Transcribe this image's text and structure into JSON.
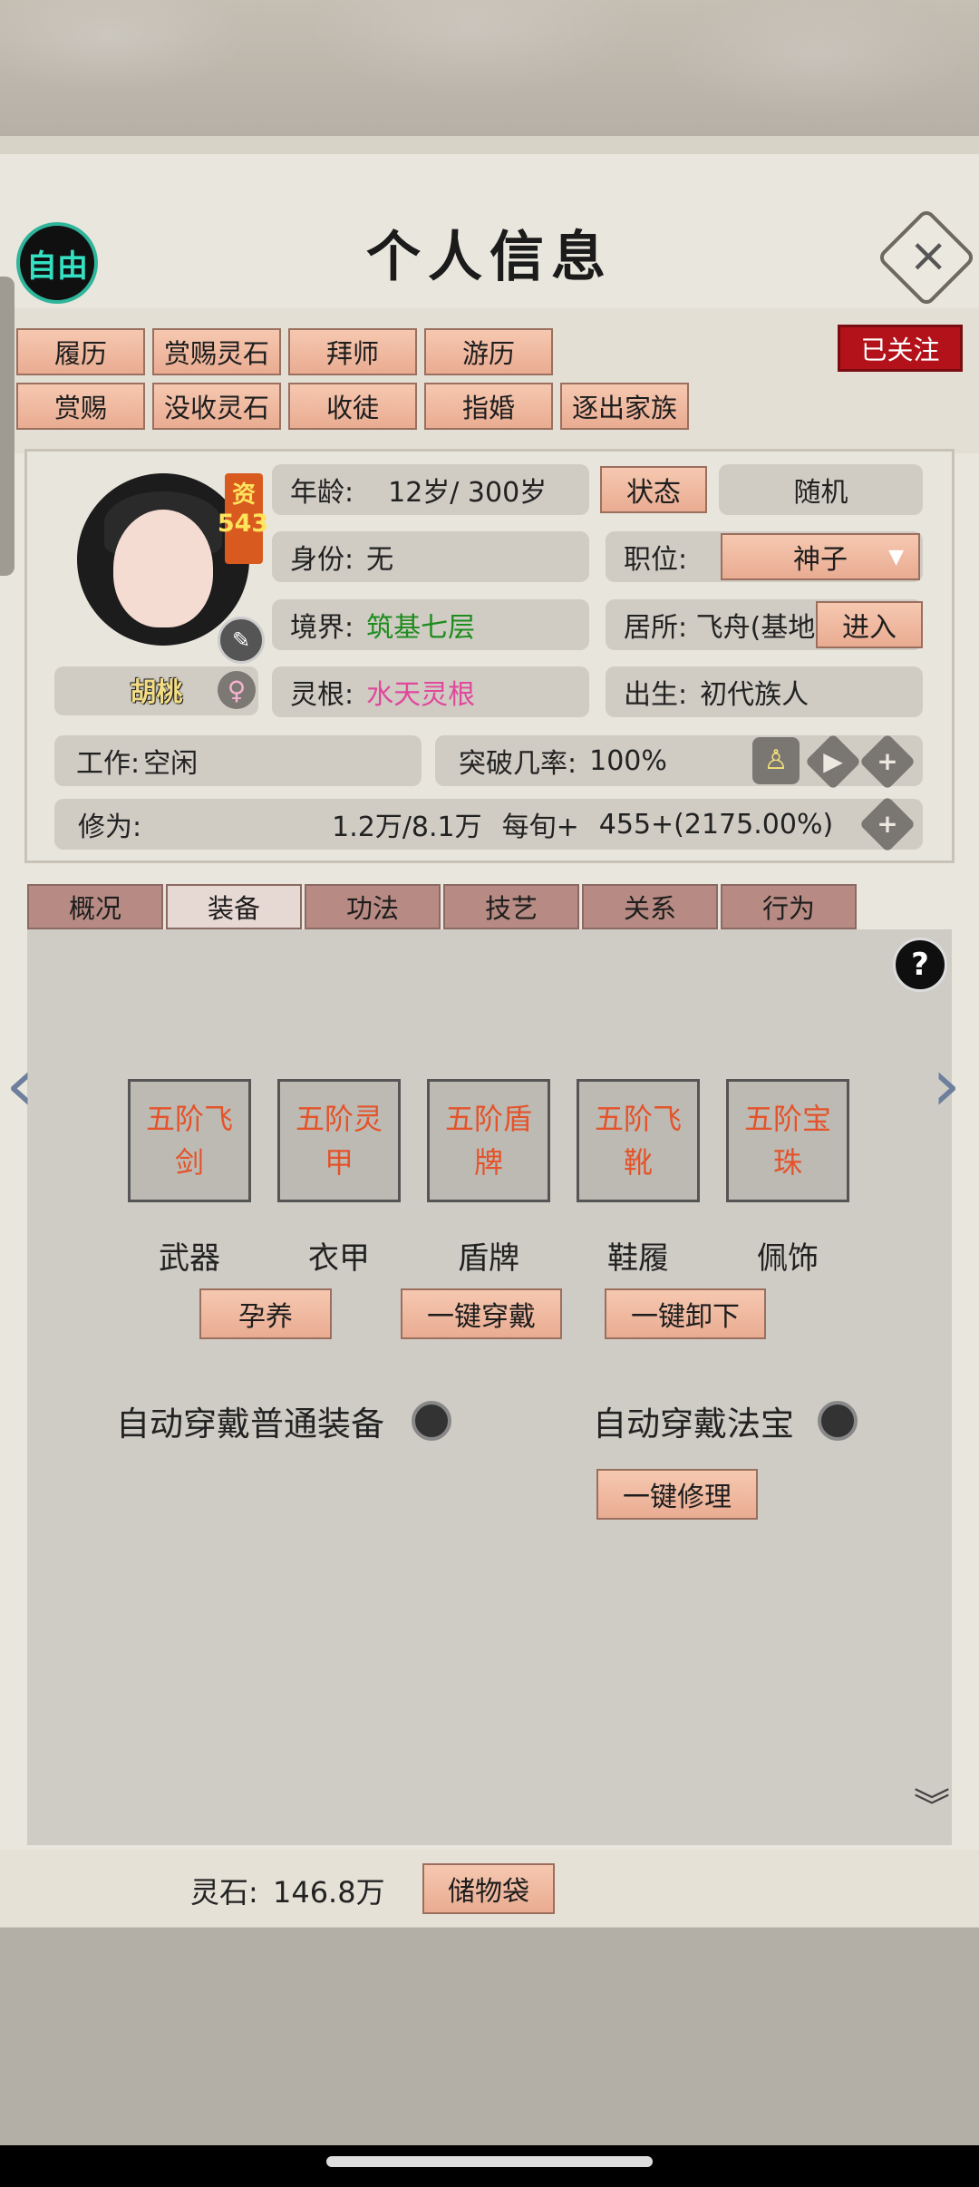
{
  "header": {
    "free_label": "自由",
    "title": "个人信息",
    "close_icon": "close-icon",
    "followed_label": "已关注"
  },
  "top_tabs_row1": [
    "履历",
    "赏赐灵石",
    "拜师",
    "游历"
  ],
  "top_tabs_row2": [
    "赏赐",
    "没收灵石",
    "收徒",
    "指婚",
    "逐出家族"
  ],
  "profile": {
    "aptitude_label": "资",
    "aptitude_value": "543",
    "name": "胡桃",
    "gender_icon": "female-icon",
    "age_label": "年龄:",
    "age_value": "12岁/ 300岁",
    "status_button": "状态",
    "random_button": "随机",
    "identity_label": "身份:",
    "identity_value": "无",
    "position_label": "职位:",
    "position_value": "神子",
    "realm_label": "境界:",
    "realm_value": "筑基七层",
    "residence_label": "居所: 飞舟(基地",
    "enter_button": "进入",
    "root_label": "灵根:",
    "root_value": "水天灵根",
    "birth_label": "出生:",
    "birth_value": "初代族人",
    "work_label": "工作:",
    "work_value": "空闲",
    "breakthrough_label": "突破几率:",
    "breakthrough_value": "100%",
    "cultivation_label": "修为:",
    "cultivation_value": "1.2万/8.1万",
    "per_turn_label": "每旬+",
    "per_turn_value": "455+(2175.00%)"
  },
  "colors": {
    "realm": "#1e8c1e",
    "root": "#e0489c",
    "slot_text": "#e4532a",
    "followed_bg": "#b3121a"
  },
  "sub_tabs": [
    "概况",
    "装备",
    "功法",
    "技艺",
    "关系",
    "行为"
  ],
  "active_sub_tab": "装备",
  "equipment": {
    "slots": [
      {
        "item": "五阶飞剑",
        "label": "武器"
      },
      {
        "item": "五阶灵甲",
        "label": "衣甲"
      },
      {
        "item": "五阶盾牌",
        "label": "盾牌"
      },
      {
        "item": "五阶飞靴",
        "label": "鞋履"
      },
      {
        "item": "五阶宝珠",
        "label": "佩饰"
      }
    ],
    "nurture_button": "孕养",
    "equip_all_button": "一键穿戴",
    "unequip_all_button": "一键卸下",
    "auto_normal_label": "自动穿戴普通装备",
    "auto_treasure_label": "自动穿戴法宝",
    "repair_button": "一键修理"
  },
  "footer": {
    "money_label": "灵石:",
    "money_value": "146.8万",
    "bag_button": "储物袋"
  }
}
